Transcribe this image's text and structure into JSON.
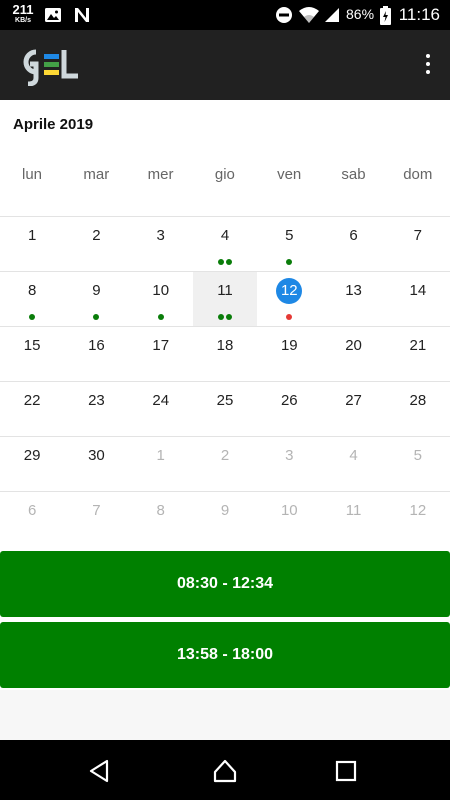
{
  "status_bar": {
    "net_speed_value": "211",
    "net_speed_unit": "KB/s",
    "battery": "86%",
    "time": "11:16",
    "icons": [
      "image-icon",
      "n-app-icon",
      "do-not-disturb-icon",
      "wifi-icon",
      "signal-icon",
      "battery-charging-icon"
    ]
  },
  "app_bar": {
    "logo_text": "GEL",
    "logo_colors": [
      "#1e88e5",
      "#43a047",
      "#fdd835"
    ],
    "menu_icon": "more-vert-icon"
  },
  "calendar": {
    "month_title": "Aprile 2019",
    "weekdays": [
      "lun",
      "mar",
      "mer",
      "gio",
      "ven",
      "sab",
      "dom"
    ],
    "weeks": [
      [
        {
          "d": "1"
        },
        {
          "d": "2"
        },
        {
          "d": "3"
        },
        {
          "d": "4",
          "dots": [
            "green",
            "green"
          ]
        },
        {
          "d": "5",
          "dots": [
            "green"
          ]
        },
        {
          "d": "6"
        },
        {
          "d": "7"
        }
      ],
      [
        {
          "d": "8",
          "dots": [
            "green"
          ]
        },
        {
          "d": "9",
          "dots": [
            "green"
          ]
        },
        {
          "d": "10",
          "dots": [
            "green"
          ]
        },
        {
          "d": "11",
          "selected": true,
          "dots": [
            "green",
            "green"
          ]
        },
        {
          "d": "12",
          "today": true,
          "dots": [
            "red"
          ]
        },
        {
          "d": "13"
        },
        {
          "d": "14"
        }
      ],
      [
        {
          "d": "15"
        },
        {
          "d": "16"
        },
        {
          "d": "17"
        },
        {
          "d": "18"
        },
        {
          "d": "19"
        },
        {
          "d": "20"
        },
        {
          "d": "21"
        }
      ],
      [
        {
          "d": "22"
        },
        {
          "d": "23"
        },
        {
          "d": "24"
        },
        {
          "d": "25"
        },
        {
          "d": "26"
        },
        {
          "d": "27"
        },
        {
          "d": "28"
        }
      ],
      [
        {
          "d": "29"
        },
        {
          "d": "30"
        },
        {
          "d": "1",
          "other": true
        },
        {
          "d": "2",
          "other": true
        },
        {
          "d": "3",
          "other": true
        },
        {
          "d": "4",
          "other": true
        },
        {
          "d": "5",
          "other": true
        }
      ],
      [
        {
          "d": "6",
          "other": true
        },
        {
          "d": "7",
          "other": true
        },
        {
          "d": "8",
          "other": true
        },
        {
          "d": "9",
          "other": true
        },
        {
          "d": "10",
          "other": true
        },
        {
          "d": "11",
          "other": true
        },
        {
          "d": "12",
          "other": true
        }
      ]
    ],
    "colors": {
      "today": "#1e88e5",
      "event_green": "#0a7d0a",
      "event_red": "#e53935"
    }
  },
  "time_slots": [
    {
      "label": "08:30 - 12:34"
    },
    {
      "label": "13:58 - 18:00"
    }
  ],
  "nav_bar": {
    "icons": [
      "back-icon",
      "home-icon",
      "recents-icon"
    ]
  }
}
